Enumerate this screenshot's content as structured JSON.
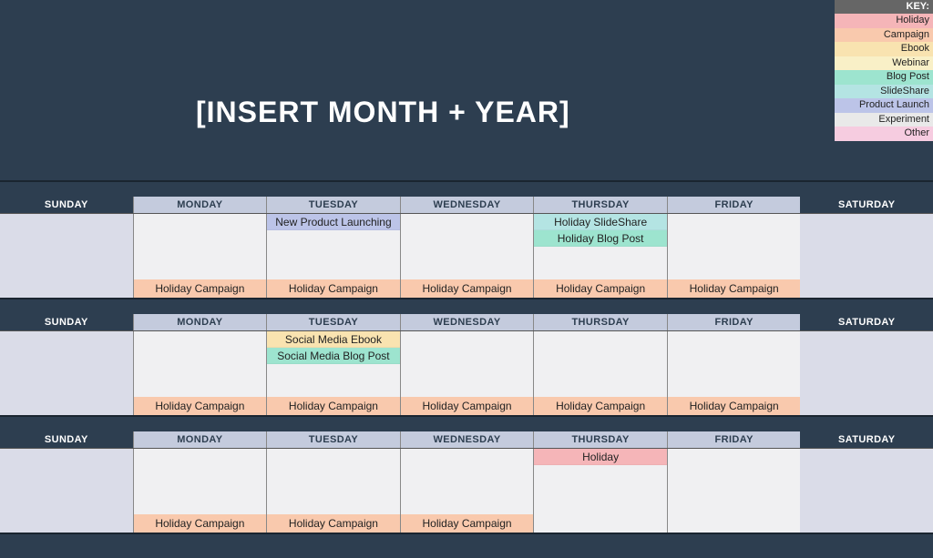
{
  "title": "[INSERT MONTH + YEAR]",
  "key": {
    "header": "KEY:",
    "items": [
      {
        "label": "Holiday",
        "cls": "c-holiday"
      },
      {
        "label": "Campaign",
        "cls": "c-campaign"
      },
      {
        "label": "Ebook",
        "cls": "c-ebook"
      },
      {
        "label": "Webinar",
        "cls": "c-webinar"
      },
      {
        "label": "Blog Post",
        "cls": "c-blogpost"
      },
      {
        "label": "SlideShare",
        "cls": "c-slideshare"
      },
      {
        "label": "Product Launch",
        "cls": "c-launch"
      },
      {
        "label": "Experiment",
        "cls": "c-experiment"
      },
      {
        "label": "Other",
        "cls": "c-other"
      }
    ]
  },
  "days": [
    "SUNDAY",
    "MONDAY",
    "TUESDAY",
    "WEDNESDAY",
    "THURSDAY",
    "FRIDAY",
    "SATURDAY"
  ],
  "weeks": [
    {
      "cells": [
        {
          "weekend": true,
          "top": [],
          "bottom": null
        },
        {
          "weekend": false,
          "top": [],
          "bottom": {
            "label": "Holiday Campaign",
            "cls": "c-campaign"
          }
        },
        {
          "weekend": false,
          "top": [
            {
              "label": "New Product Launching",
              "cls": "c-launch"
            }
          ],
          "bottom": {
            "label": "Holiday Campaign",
            "cls": "c-campaign"
          }
        },
        {
          "weekend": false,
          "top": [],
          "bottom": {
            "label": "Holiday Campaign",
            "cls": "c-campaign"
          }
        },
        {
          "weekend": false,
          "top": [
            {
              "label": "Holiday SlideShare",
              "cls": "c-slideshare"
            },
            {
              "label": "Holiday Blog Post",
              "cls": "c-blogpost"
            }
          ],
          "bottom": {
            "label": "Holiday Campaign",
            "cls": "c-campaign"
          }
        },
        {
          "weekend": false,
          "top": [],
          "bottom": {
            "label": "Holiday Campaign",
            "cls": "c-campaign"
          }
        },
        {
          "weekend": true,
          "top": [],
          "bottom": null
        }
      ]
    },
    {
      "cells": [
        {
          "weekend": true,
          "top": [],
          "bottom": null
        },
        {
          "weekend": false,
          "top": [],
          "bottom": {
            "label": "Holiday Campaign",
            "cls": "c-campaign"
          }
        },
        {
          "weekend": false,
          "top": [
            {
              "label": "Social Media Ebook",
              "cls": "c-ebook"
            },
            {
              "label": "Social Media Blog Post",
              "cls": "c-blogpost"
            }
          ],
          "bottom": {
            "label": "Holiday Campaign",
            "cls": "c-campaign"
          }
        },
        {
          "weekend": false,
          "top": [],
          "bottom": {
            "label": "Holiday Campaign",
            "cls": "c-campaign"
          }
        },
        {
          "weekend": false,
          "top": [],
          "bottom": {
            "label": "Holiday Campaign",
            "cls": "c-campaign"
          }
        },
        {
          "weekend": false,
          "top": [],
          "bottom": {
            "label": "Holiday Campaign",
            "cls": "c-campaign"
          }
        },
        {
          "weekend": true,
          "top": [],
          "bottom": null
        }
      ]
    },
    {
      "cells": [
        {
          "weekend": true,
          "top": [],
          "bottom": null
        },
        {
          "weekend": false,
          "top": [],
          "bottom": {
            "label": "Holiday Campaign",
            "cls": "c-campaign"
          }
        },
        {
          "weekend": false,
          "top": [],
          "bottom": {
            "label": "Holiday Campaign",
            "cls": "c-campaign"
          }
        },
        {
          "weekend": false,
          "top": [],
          "bottom": {
            "label": "Holiday Campaign",
            "cls": "c-campaign"
          }
        },
        {
          "weekend": false,
          "top": [
            {
              "label": "Holiday",
              "cls": "c-holiday"
            }
          ],
          "bottom": null
        },
        {
          "weekend": false,
          "top": [],
          "bottom": null
        },
        {
          "weekend": true,
          "top": [],
          "bottom": null
        }
      ]
    }
  ]
}
